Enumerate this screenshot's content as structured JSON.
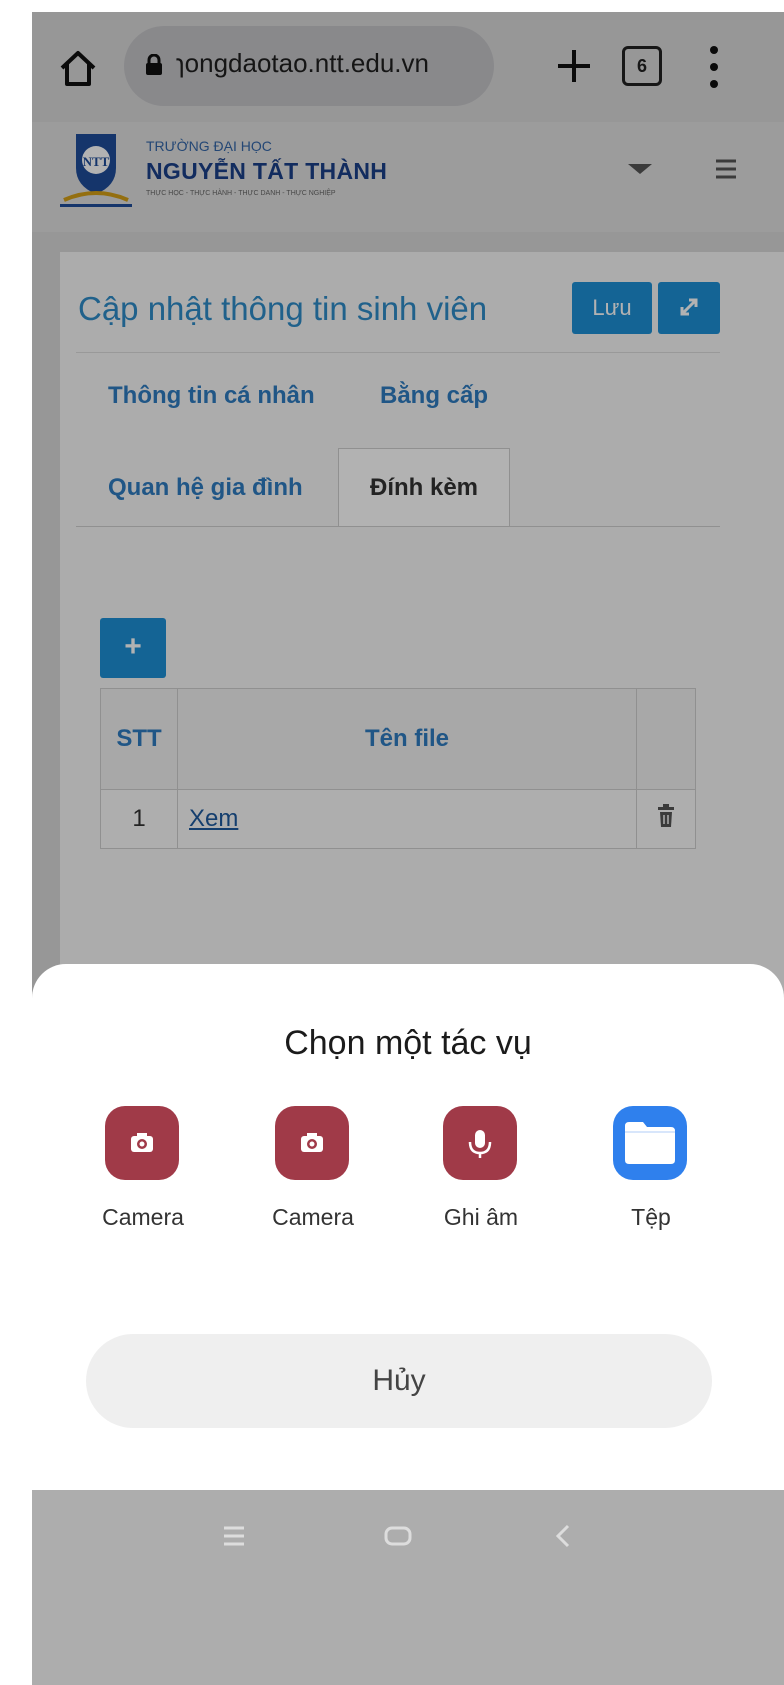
{
  "browser": {
    "url": "ɿongdaotao.ntt.edu.vn",
    "tab_count": "6"
  },
  "site": {
    "university_small": "TRƯỜNG ĐẠI HỌC",
    "university_name": "NGUYỄN TẤT THÀNH",
    "motto": "THỰC HỌC - THỰC HÀNH - THỰC DANH - THỰC NGHIỆP",
    "logo_text": "NTT"
  },
  "page": {
    "title": "Cập nhật thông tin sinh viên",
    "save_label": "Lưu",
    "tabs": [
      {
        "label": "Thông tin cá nhân"
      },
      {
        "label": "Bằng cấp"
      },
      {
        "label": "Quan hệ gia đình"
      },
      {
        "label": "Đính kèm"
      }
    ],
    "active_tab": "Đính kèm",
    "add_label": "+",
    "table": {
      "headers": [
        "STT",
        "Tên file",
        ""
      ],
      "rows": [
        {
          "stt": "1",
          "name": "Xem"
        }
      ]
    }
  },
  "sheet": {
    "title": "Chọn một tác vụ",
    "actions": [
      {
        "label": "Camera",
        "icon": "camera-icon"
      },
      {
        "label": "Camera",
        "icon": "camera-icon"
      },
      {
        "label": "Ghi âm",
        "icon": "microphone-icon"
      },
      {
        "label": "Tệp",
        "icon": "folder-icon"
      }
    ],
    "cancel_label": "Hủy"
  },
  "colors": {
    "primary": "#1e90d6",
    "action_red": "#a03a48",
    "folder_blue": "#2f80ed"
  }
}
